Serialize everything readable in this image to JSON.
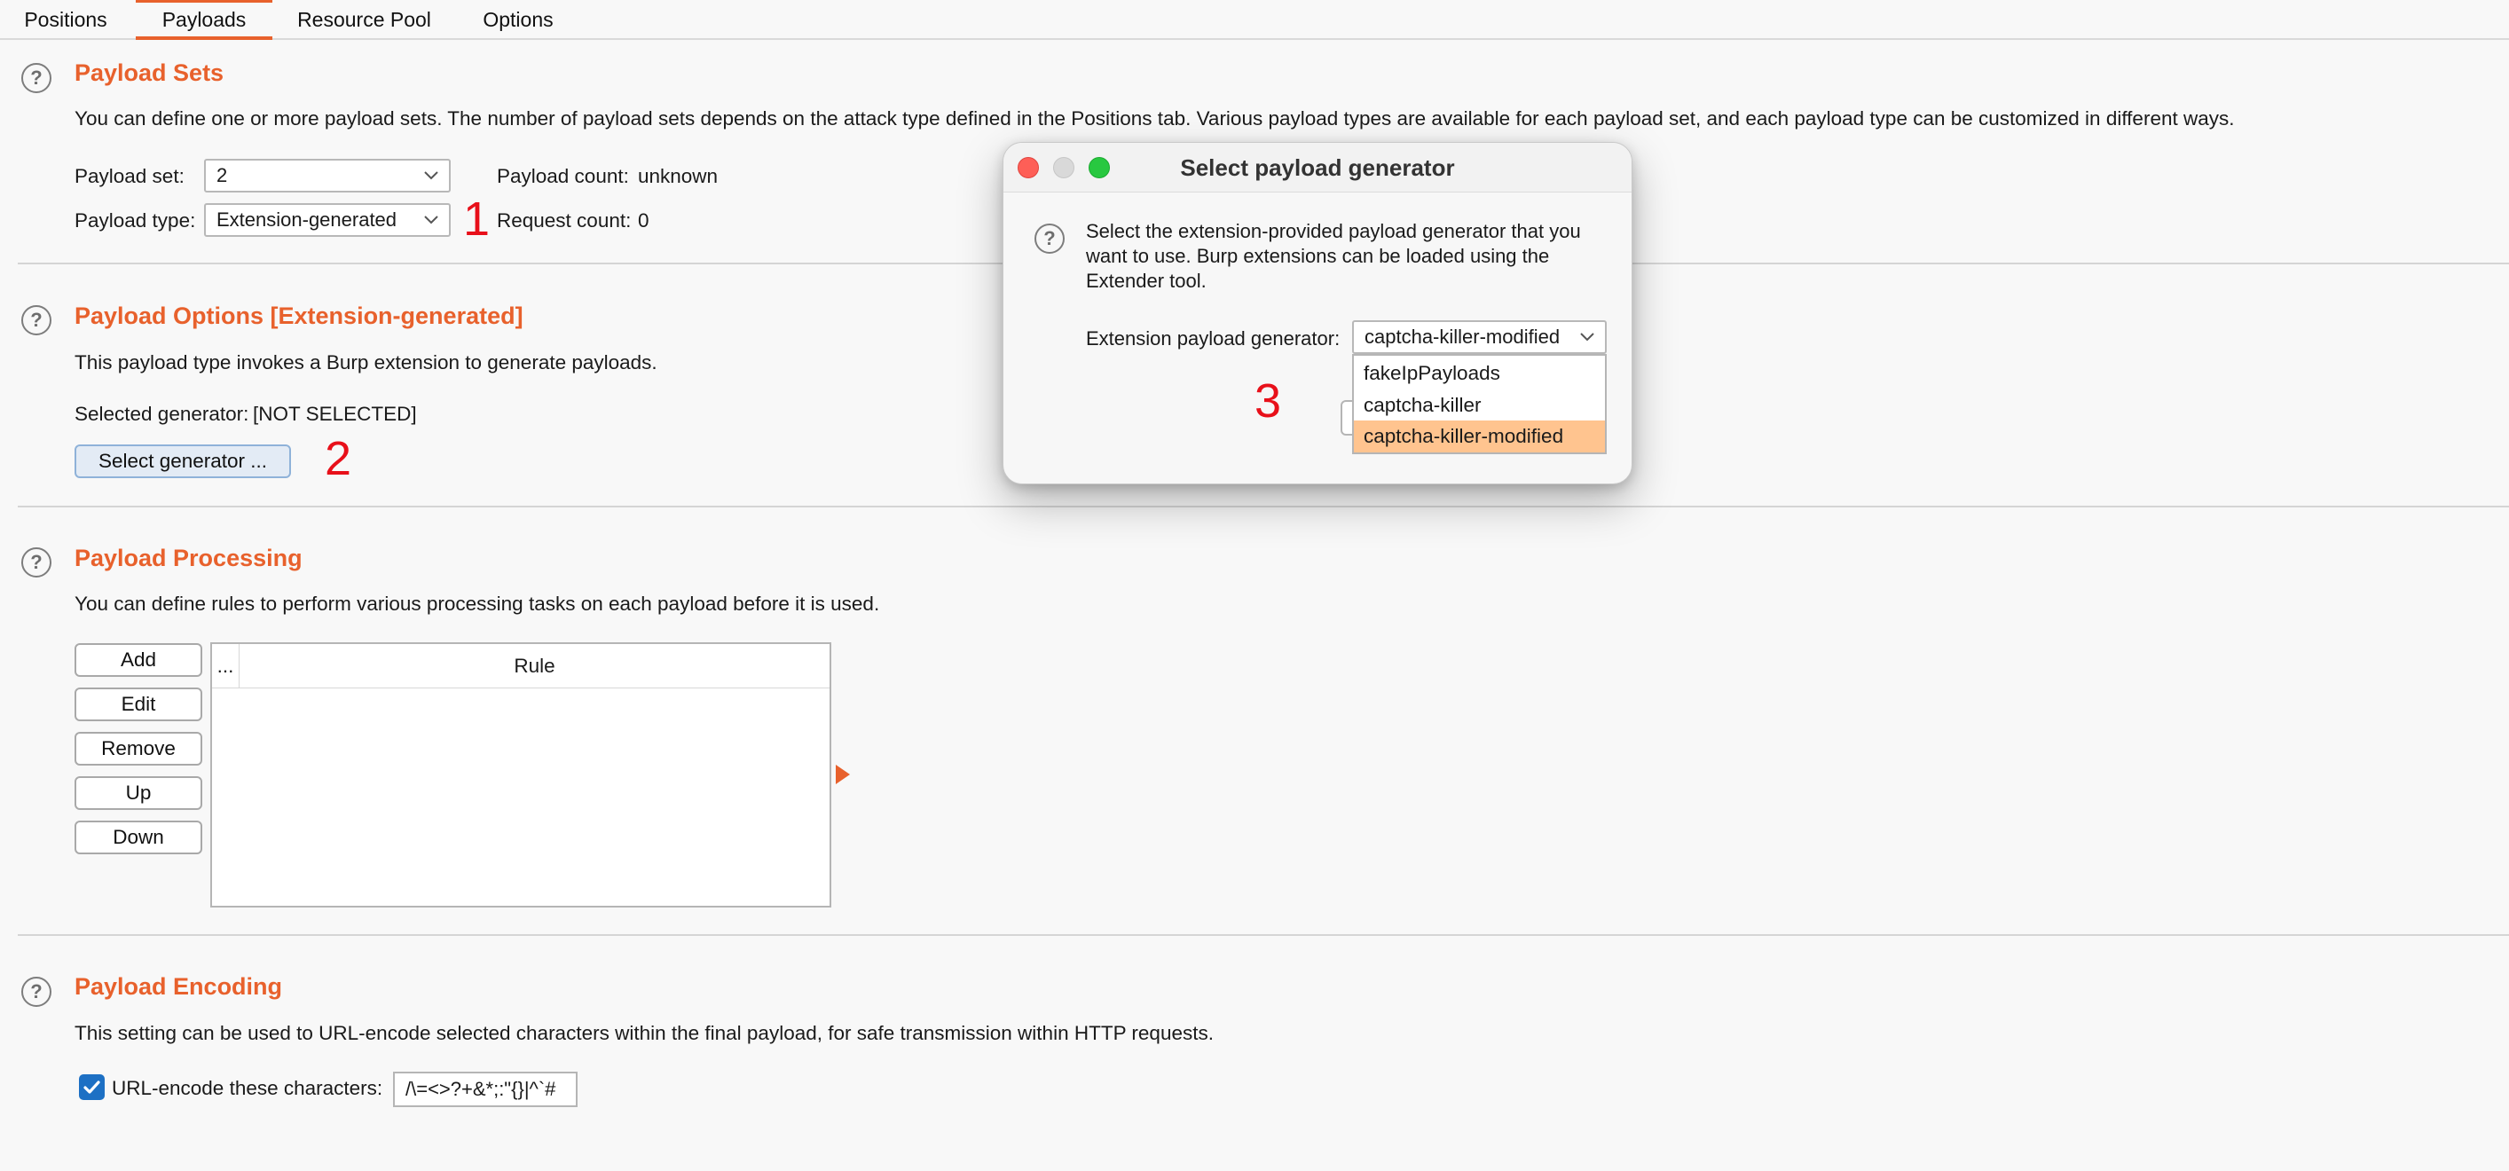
{
  "tabs": [
    "Positions",
    "Payloads",
    "Resource Pool",
    "Options"
  ],
  "payload_sets": {
    "title": "Payload Sets",
    "description": "You can define one or more payload sets. The number of payload sets depends on the attack type defined in the Positions tab. Various payload types are available for each payload set, and each payload type can be customized in different ways.",
    "set_label": "Payload set:",
    "set_value": "2",
    "type_label": "Payload type:",
    "type_value": "Extension-generated",
    "count_label": "Payload count:",
    "count_value": "unknown",
    "request_label": "Request count:",
    "request_value": "0"
  },
  "payload_options": {
    "title": "Payload Options [Extension-generated]",
    "description": "This payload type invokes a Burp extension to generate payloads.",
    "selected_label": "Selected generator:",
    "selected_value": "[NOT SELECTED]",
    "select_button": "Select generator ..."
  },
  "payload_processing": {
    "title": "Payload Processing",
    "description": "You can define rules to perform various processing tasks on each payload before it is used.",
    "buttons": [
      "Add",
      "Edit",
      "Remove",
      "Up",
      "Down"
    ],
    "columns": [
      "...",
      "Rule"
    ]
  },
  "payload_encoding": {
    "title": "Payload Encoding",
    "description": "This setting can be used to URL-encode selected characters within the final payload, for safe transmission within HTTP requests.",
    "checkbox_label": "URL-encode these characters:",
    "checkbox_checked": true,
    "chars_value": "/\\=<>?+&*;:\"{}|^`#"
  },
  "annotations": [
    "1",
    "2",
    "3"
  ],
  "dialog": {
    "title": "Select payload generator",
    "message": "Select the extension-provided payload generator that you want to use. Burp extensions can be loaded using the Extender tool.",
    "generator_label": "Extension payload generator:",
    "generator_value": "captcha-killer-modified",
    "options": [
      "fakeIpPayloads",
      "captcha-killer",
      "captcha-killer-modified"
    ],
    "selected_option": "captcha-killer-modified"
  },
  "colors": {
    "accent": "#e8612c",
    "annotation": "#e8101a",
    "selected_option": "#ffc48f",
    "checkbox": "#1d70c4"
  }
}
